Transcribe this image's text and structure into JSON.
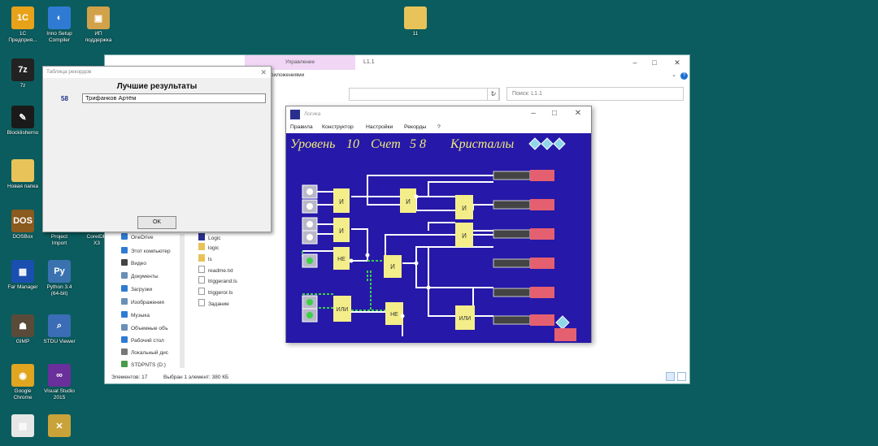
{
  "desktop_icons": [
    {
      "id": "1c",
      "label": "1С\nПредприя...",
      "color": "#e8a21a",
      "glyph": "1С"
    },
    {
      "id": "inno",
      "label": "Inno Setup\nCompiler",
      "color": "#2f7bd3",
      "glyph": "◐"
    },
    {
      "id": "support",
      "label": "ИП\nподдержка",
      "color": "#d2a24a",
      "glyph": "▣"
    },
    {
      "id": "7z",
      "label": "7z",
      "color": "#222222",
      "glyph": "7z"
    },
    {
      "id": "blocks",
      "label": "Blocklisherno",
      "color": "#1a1a1a",
      "glyph": "✎"
    },
    {
      "id": "newfolder",
      "label": "Новая папка",
      "color": "#e8c35a",
      "glyph": ""
    },
    {
      "id": "dosbox",
      "label": "DOSBox",
      "color": "#8a5a1e",
      "glyph": "DOS"
    },
    {
      "id": "project",
      "label": "Project\nImport",
      "color": "#3a6db5",
      "glyph": ""
    },
    {
      "id": "coredraw",
      "label": "CorelDR\nX3",
      "color": "#2f9a46",
      "glyph": ""
    },
    {
      "id": "farmgr",
      "label": "Far Manager",
      "color": "#1a4fb0",
      "glyph": "▦"
    },
    {
      "id": "python",
      "label": "Python 3.4\n(64-bit)",
      "color": "#3a72b0",
      "glyph": "Py"
    },
    {
      "id": "gimp",
      "label": "GIMP",
      "color": "#5a4a3a",
      "glyph": "☗"
    },
    {
      "id": "stdu",
      "label": "STDU Viewer",
      "color": "#3a6db5",
      "glyph": "⌕"
    },
    {
      "id": "chrome",
      "label": "Google\nChrome",
      "color": "#e1a520",
      "glyph": "◉"
    },
    {
      "id": "vs",
      "label": "Visual Studio\n2015",
      "color": "#6a2f9a",
      "glyph": "∞"
    },
    {
      "id": "misc1",
      "label": "",
      "color": "#e6e6e6",
      "glyph": "▤"
    },
    {
      "id": "misc2",
      "label": "",
      "color": "#c9a23a",
      "glyph": "✕"
    },
    {
      "id": "folder11",
      "label": "11",
      "color": "#e8c35a",
      "glyph": ""
    }
  ],
  "explorer": {
    "manage_tab": "Управление",
    "title": "L1.1",
    "ribbon_label": "Работа с приложениями",
    "search_placeholder": "Поиск: L1.1",
    "nav": [
      "OneDrive",
      "Этот компьютер",
      "Видео",
      "Документы",
      "Загрузки",
      "Изображения",
      "Музыка",
      "Объемные объ",
      "Рабочий стол",
      "Локальный дис",
      "STDPNTS (D:)"
    ],
    "files": [
      "Logic",
      "logic",
      "ls",
      "readme.txt",
      "triggerand.ls",
      "triggeror.ls",
      "Задание"
    ],
    "status_count": "Элементов: 17",
    "status_selected": "Выбран 1 элемент: 380 КБ"
  },
  "records_dialog": {
    "window_title": "Таблица рекордов",
    "heading": "Лучшие результаты",
    "score": "58",
    "player": "Трифанков Артём",
    "ok_label": "OK"
  },
  "logic_window": {
    "title": "Логика",
    "menu": [
      "Правила",
      "Конструктор",
      "Настройки",
      "Рекорды",
      "?"
    ],
    "level_label": "Уровень",
    "level": "10",
    "score_label": "Счет",
    "score": "5 8",
    "crystals_label": "Кристаллы",
    "gates": [
      "И",
      "И",
      "НЕ",
      "ИЛИ",
      "И",
      "И",
      "НЕ",
      "И",
      "И",
      "ИЛИ"
    ]
  },
  "colors": {
    "desktop": "#0b5c5e",
    "game_bg": "#2618a8",
    "gate": "#f4ee8a",
    "lamp": "#e46070",
    "wire": "#ffffff",
    "signal": "#3bd14a"
  }
}
